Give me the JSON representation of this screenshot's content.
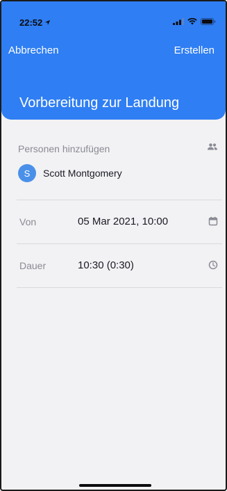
{
  "status_bar": {
    "time": "22:52",
    "location_icon": "location-arrow-icon",
    "signal_icon": "cellular-signal-icon",
    "wifi_icon": "wifi-icon",
    "battery_icon": "battery-icon"
  },
  "nav": {
    "cancel_label": "Abbrechen",
    "create_label": "Erstellen"
  },
  "title": "Vorbereitung zur Landung",
  "people": {
    "label": "Personen hinzufügen",
    "icon": "people-icon",
    "list": [
      {
        "initial": "S",
        "name": "Scott Montgomery"
      }
    ]
  },
  "fields": {
    "from": {
      "label": "Von",
      "value": "05 Mar 2021, 10:00",
      "icon": "calendar-icon"
    },
    "duration": {
      "label": "Dauer",
      "value": "10:30 (0:30)",
      "icon": "clock-icon"
    }
  },
  "colors": {
    "header": "#2f7ef3",
    "avatar": "#4a90e8",
    "background": "#f2f2f4"
  }
}
